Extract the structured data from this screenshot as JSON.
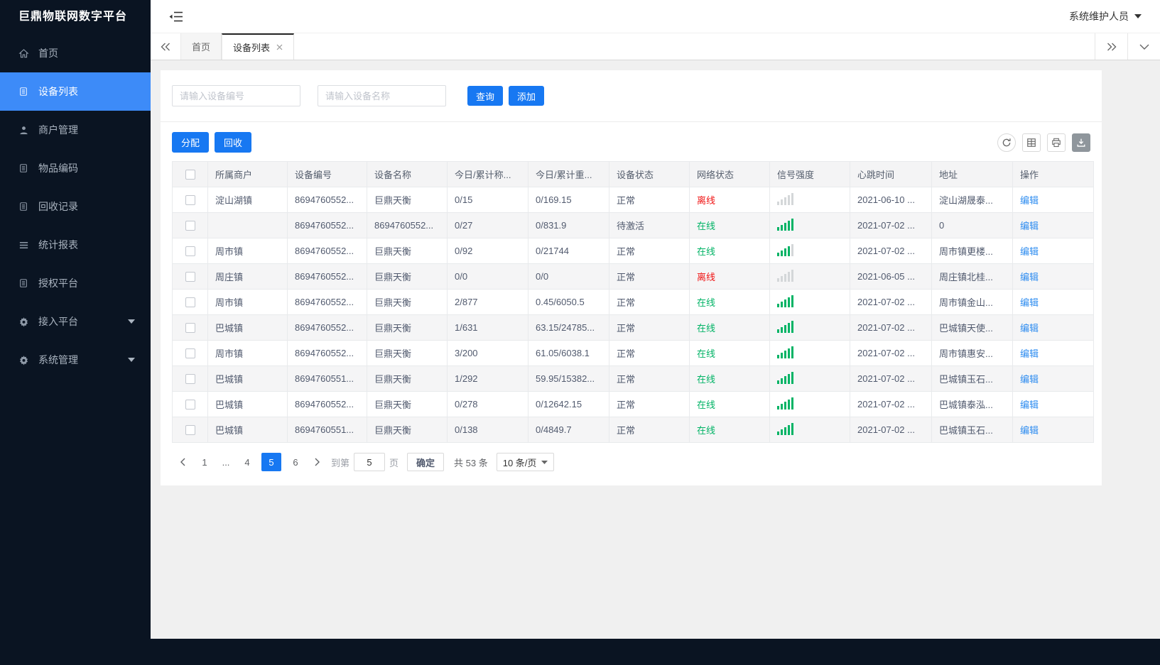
{
  "colors": {
    "accent_blue": "#1778f2",
    "sidebar_active_blue": "#3d8bf8",
    "online_green": "#00b365",
    "offline_red": "#f01414",
    "link_blue": "#2d8cf0",
    "sidebar_bg": "#0a1422"
  },
  "sidebar": {
    "title": "巨鼎物联网数字平台",
    "items": [
      {
        "id": "home",
        "label": "首页",
        "icon": "home-icon",
        "active": false,
        "expandable": false
      },
      {
        "id": "device-list",
        "label": "设备列表",
        "icon": "doc-icon",
        "active": true,
        "expandable": false
      },
      {
        "id": "merchant-management",
        "label": "商户管理",
        "icon": "user-icon",
        "active": false,
        "expandable": false
      },
      {
        "id": "item-coding",
        "label": "物品编码",
        "icon": "doc-icon",
        "active": false,
        "expandable": false
      },
      {
        "id": "recycle-records",
        "label": "回收记录",
        "icon": "doc-icon",
        "active": false,
        "expandable": false
      },
      {
        "id": "statistics-report",
        "label": "统计报表",
        "icon": "menu-icon",
        "active": false,
        "expandable": false
      },
      {
        "id": "authorization-platform",
        "label": "授权平台",
        "icon": "doc-icon",
        "active": false,
        "expandable": false
      },
      {
        "id": "access-platform",
        "label": "接入平台",
        "icon": "gear-icon",
        "active": false,
        "expandable": true
      },
      {
        "id": "system-management",
        "label": "系统管理",
        "icon": "gear-icon",
        "active": false,
        "expandable": true
      }
    ]
  },
  "header": {
    "user_role": "系统维护人员"
  },
  "tabs": [
    {
      "id": "home",
      "label": "首页",
      "active": false,
      "closable": false
    },
    {
      "id": "device-list",
      "label": "设备列表",
      "active": true,
      "closable": true
    }
  ],
  "search": {
    "device_no_placeholder": "请输入设备编号",
    "device_name_placeholder": "请输入设备名称",
    "query_label": "查询",
    "add_label": "添加"
  },
  "toolbar": {
    "assign_label": "分配",
    "recycle_label": "回收",
    "icons": [
      "refresh-icon",
      "grid-icon",
      "printer-icon",
      "download-icon"
    ]
  },
  "table": {
    "columns": [
      "所属商户",
      "设备编号",
      "设备名称",
      "今日/累计称...",
      "今日/累计重...",
      "设备状态",
      "网络状态",
      "信号强度",
      "心跳时间",
      "地址",
      "操作"
    ],
    "edit_label": "编辑",
    "rows": [
      {
        "merchant": "淀山湖镇",
        "device_no": "8694760552...",
        "device_name": "巨鼎天衡",
        "today_count": "0/15",
        "today_weight": "0/169.15",
        "device_status": "正常",
        "network_status": "离线",
        "online": false,
        "signal": 0,
        "heartbeat": "2021-06-10 ...",
        "address": "淀山湖晟泰..."
      },
      {
        "merchant": "",
        "device_no": "8694760552...",
        "device_name": "8694760552...",
        "today_count": "0/27",
        "today_weight": "0/831.9",
        "device_status": "待激活",
        "network_status": "在线",
        "online": true,
        "signal": 5,
        "heartbeat": "2021-07-02 ...",
        "address": "0"
      },
      {
        "merchant": "周市镇",
        "device_no": "8694760552...",
        "device_name": "巨鼎天衡",
        "today_count": "0/92",
        "today_weight": "0/21744",
        "device_status": "正常",
        "network_status": "在线",
        "online": true,
        "signal": 4,
        "heartbeat": "2021-07-02 ...",
        "address": "周市镇更楼..."
      },
      {
        "merchant": "周庄镇",
        "device_no": "8694760552...",
        "device_name": "巨鼎天衡",
        "today_count": "0/0",
        "today_weight": "0/0",
        "device_status": "正常",
        "network_status": "离线",
        "online": false,
        "signal": 0,
        "heartbeat": "2021-06-05 ...",
        "address": "周庄镇北桂..."
      },
      {
        "merchant": "周市镇",
        "device_no": "8694760552...",
        "device_name": "巨鼎天衡",
        "today_count": "2/877",
        "today_weight": "0.45/6050.5",
        "device_status": "正常",
        "network_status": "在线",
        "online": true,
        "signal": 5,
        "heartbeat": "2021-07-02 ...",
        "address": "周市镇金山..."
      },
      {
        "merchant": "巴城镇",
        "device_no": "8694760552...",
        "device_name": "巨鼎天衡",
        "today_count": "1/631",
        "today_weight": "63.15/24785...",
        "device_status": "正常",
        "network_status": "在线",
        "online": true,
        "signal": 5,
        "heartbeat": "2021-07-02 ...",
        "address": "巴城镇天使..."
      },
      {
        "merchant": "周市镇",
        "device_no": "8694760552...",
        "device_name": "巨鼎天衡",
        "today_count": "3/200",
        "today_weight": "61.05/6038.1",
        "device_status": "正常",
        "network_status": "在线",
        "online": true,
        "signal": 5,
        "heartbeat": "2021-07-02 ...",
        "address": "周市镇惠安..."
      },
      {
        "merchant": "巴城镇",
        "device_no": "8694760551...",
        "device_name": "巨鼎天衡",
        "today_count": "1/292",
        "today_weight": "59.95/15382...",
        "device_status": "正常",
        "network_status": "在线",
        "online": true,
        "signal": 5,
        "heartbeat": "2021-07-02 ...",
        "address": "巴城镇玉石..."
      },
      {
        "merchant": "巴城镇",
        "device_no": "8694760552...",
        "device_name": "巨鼎天衡",
        "today_count": "0/278",
        "today_weight": "0/12642.15",
        "device_status": "正常",
        "network_status": "在线",
        "online": true,
        "signal": 5,
        "heartbeat": "2021-07-02 ...",
        "address": "巴城镇泰泓..."
      },
      {
        "merchant": "巴城镇",
        "device_no": "8694760551...",
        "device_name": "巨鼎天衡",
        "today_count": "0/138",
        "today_weight": "0/4849.7",
        "device_status": "正常",
        "network_status": "在线",
        "online": true,
        "signal": 5,
        "heartbeat": "2021-07-02 ...",
        "address": "巴城镇玉石..."
      }
    ]
  },
  "pagination": {
    "pages": [
      "1",
      "...",
      "4",
      "5",
      "6"
    ],
    "active_page": "5",
    "goto_prefix": "到第",
    "goto_value": "5",
    "goto_suffix": "页",
    "confirm_label": "确定",
    "total_text": "共 53 条",
    "page_size": "10 条/页"
  }
}
